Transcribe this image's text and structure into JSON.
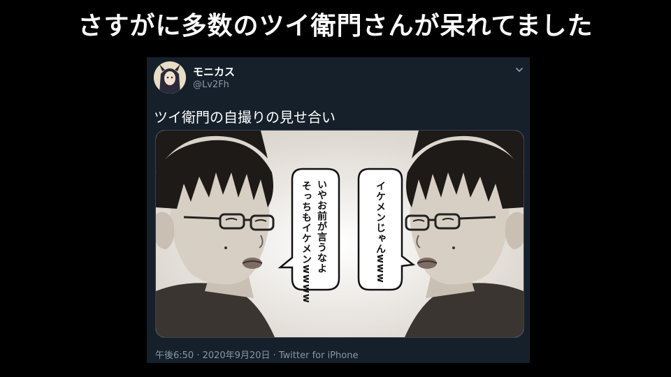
{
  "headline": "さすがに多数のツイ衛門さんが呆れてました",
  "tweet": {
    "display_name": "モニカス",
    "handle": "@Lv2Fh",
    "text": "ツイ衛門の自撮りの見せ合い",
    "timestamp": "午後6:50 · 2020年9月20日 · Twitter for iPhone",
    "menu_icon": "chevron-down-icon",
    "image": {
      "left_bubble_line1": "いやお前が言うなよ",
      "left_bubble_line2": "そっちもイケメンwwww",
      "right_bubble": "イケメンじゃんwww"
    }
  },
  "colors": {
    "background": "#000000",
    "tweet_bg": "#15202b",
    "secondary_text": "#8899a6"
  }
}
